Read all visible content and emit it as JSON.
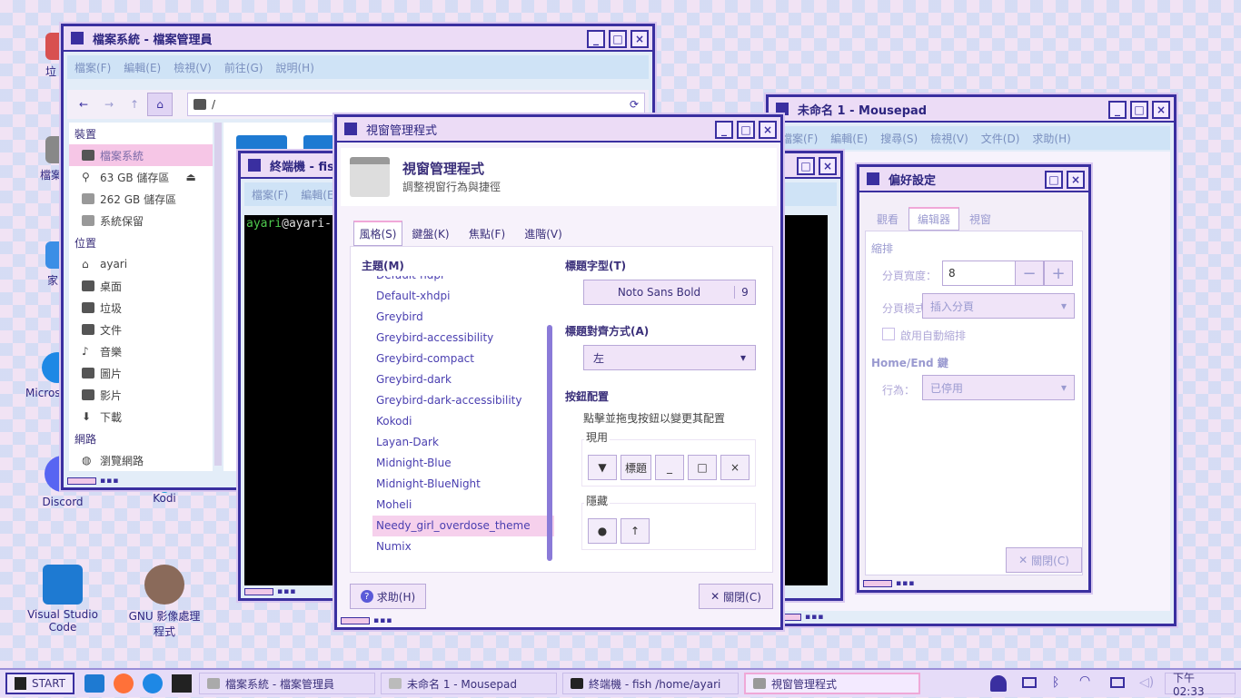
{
  "desktop": {
    "icons": [
      {
        "label": "垃",
        "color": "#d85050"
      },
      {
        "label": "檔案",
        "color": "#888"
      },
      {
        "label": "家",
        "color": "#3a8ee6"
      },
      {
        "label": "Micros",
        "color": "#1e88e5"
      },
      {
        "label": "Discord",
        "color": "#5865f2"
      },
      {
        "label": "Kodi",
        "color": "#1aa3d8"
      },
      {
        "label": "Visual Studio Code",
        "color": "#1e7ad2"
      },
      {
        "label": "GNU 影像處理程式",
        "color": "#8a6a5a"
      }
    ]
  },
  "fm": {
    "title": "檔案系統 - 檔案管理員",
    "menu": [
      "檔案(F)",
      "編輯(E)",
      "檢視(V)",
      "前往(G)",
      "說明(H)"
    ],
    "path": "/",
    "devices_header": "裝置",
    "devices": [
      "檔案系統",
      "63 GB 儲存區",
      "262 GB 儲存區",
      "系統保留"
    ],
    "places_header": "位置",
    "places": [
      "ayari",
      "桌面",
      "垃圾",
      "文件",
      "音樂",
      "圖片",
      "影片",
      "下載"
    ],
    "network_header": "網路",
    "network": [
      "瀏覽網路"
    ]
  },
  "term": {
    "title": "終端機 - fish",
    "menu": [
      "檔案(F)",
      "編輯(E"
    ],
    "prompt_user": "ayari",
    "prompt_rest": "@ayari-"
  },
  "mousepad": {
    "title": "未命名 1 - Mousepad",
    "menu": [
      "檔案(F)",
      "編輯(E)",
      "搜尋(S)",
      "檢視(V)",
      "文件(D)",
      "求助(H)"
    ]
  },
  "prefs": {
    "title": "偏好設定",
    "tabs": [
      "觀看",
      "编辑器",
      "視窗"
    ],
    "section1": "縮排",
    "tab_width_label": "分頁寬度：",
    "tab_width": "8",
    "tab_mode_label": "分頁模式：",
    "tab_mode": "插入分頁",
    "auto_indent": "啟用自動縮排",
    "section2": "Home/End 鍵",
    "behavior_label": "行為：",
    "behavior": "已停用",
    "close": "關閉(C)"
  },
  "wm": {
    "title": "視窗管理程式",
    "header_title": "視窗管理程式",
    "header_sub": "調整視窗行為與捷徑",
    "tabs": [
      "風格(S)",
      "鍵盤(K)",
      "焦點(F)",
      "進階(V)"
    ],
    "theme_label": "主題(M)",
    "themes": [
      "Default-hdpi",
      "Default-xhdpi",
      "Greybird",
      "Greybird-accessibility",
      "Greybird-compact",
      "Greybird-dark",
      "Greybird-dark-accessibility",
      "Kokodi",
      "Layan-Dark",
      "Midnight-Blue",
      "Midnight-BlueNight",
      "Moheli",
      "Needy_girl_overdose_theme",
      "Numix"
    ],
    "selected_theme": "Needy_girl_overdose_theme",
    "font_label": "標題字型(T)",
    "font_name": "Noto Sans Bold",
    "font_size": "9",
    "align_label": "標題對齊方式(A)",
    "align_value": "左",
    "layout_label": "按鈕配置",
    "layout_hint": "點擊並拖曳按鈕以變更其配置",
    "active_label": "現用",
    "active_buttons": [
      "▼",
      "標題",
      "_",
      "□",
      "×"
    ],
    "hidden_label": "隱藏",
    "hidden_buttons": [
      "●",
      "↑"
    ],
    "help": "求助(H)",
    "close": "關閉(C)"
  },
  "taskbar": {
    "start": "START",
    "tasks": [
      "檔案系統 - 檔案管理員",
      "未命名 1 - Mousepad",
      "終端機 - fish /home/ayari",
      "視窗管理程式"
    ],
    "clock": "下午 02:33"
  }
}
